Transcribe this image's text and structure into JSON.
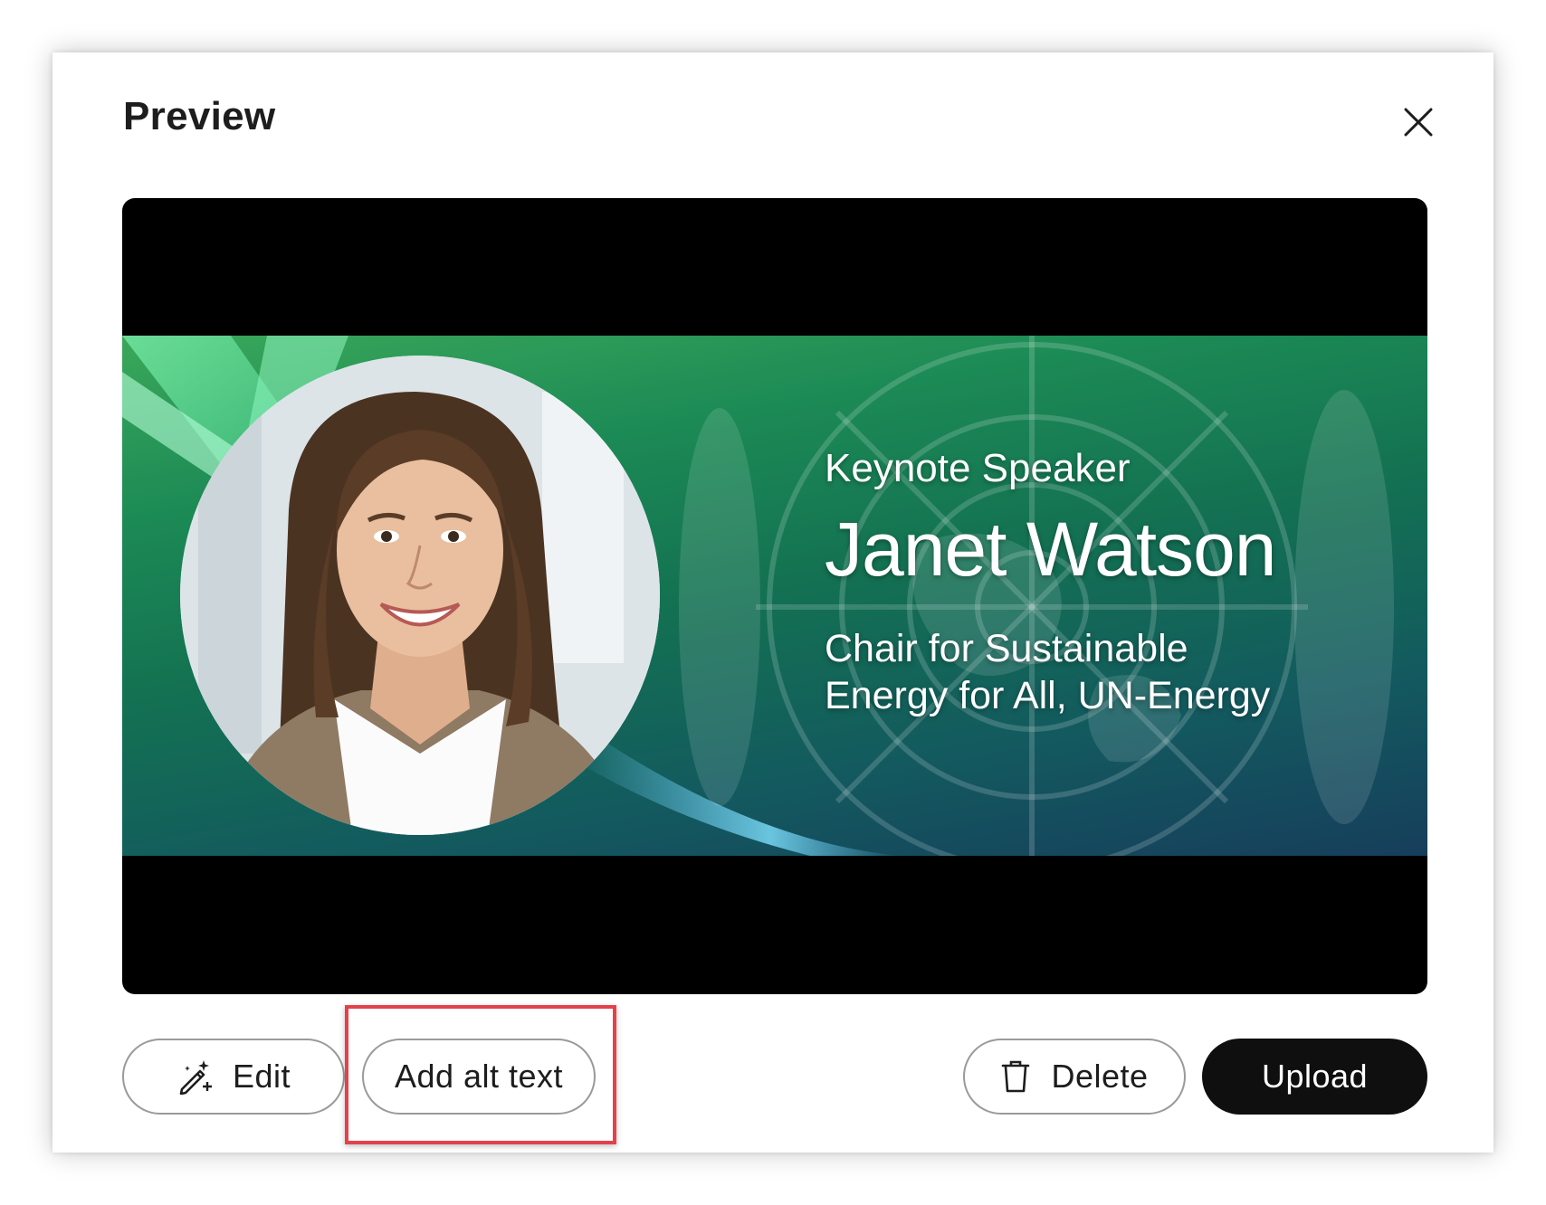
{
  "dialog": {
    "title": "Preview",
    "close_icon": "close-icon"
  },
  "preview": {
    "speaker_role": "Keynote Speaker",
    "speaker_name": "Janet Watson",
    "speaker_title_line1": "Chair for Sustainable",
    "speaker_title_line2": "Energy for All, UN-Energy"
  },
  "actions": {
    "edit_label": "Edit",
    "edit_icon": "magic-wand-edit-icon",
    "alt_text_label": "Add alt text",
    "delete_label": "Delete",
    "delete_icon": "trash-icon",
    "upload_label": "Upload"
  },
  "colors": {
    "highlight": "#e4414b",
    "upload_bg": "#0f0f0f",
    "banner_green": "#1c8a55",
    "banner_teal": "#163e5c"
  }
}
